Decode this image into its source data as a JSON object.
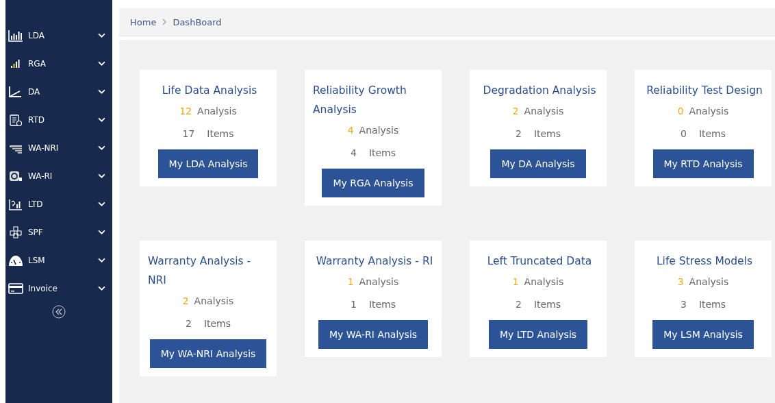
{
  "sidebar": {
    "items": [
      {
        "label": "LDA",
        "expanded": false
      },
      {
        "label": "RGA",
        "expanded": false
      },
      {
        "label": "DA",
        "expanded": false
      },
      {
        "label": "RTD",
        "expanded": false
      },
      {
        "label": "WA-NRI",
        "expanded": false
      },
      {
        "label": "WA-RI",
        "expanded": false
      },
      {
        "label": "LTD",
        "expanded": false
      },
      {
        "label": "SPF",
        "expanded": false
      },
      {
        "label": "LSM",
        "expanded": false
      },
      {
        "label": "Invoice",
        "expanded": false
      }
    ]
  },
  "breadcrumb": [
    "Home",
    "DashBoard"
  ],
  "cards": [
    {
      "title": "Life Data Analysis",
      "analysis_count": "12",
      "analysis_label": "Analysis",
      "items_count": "17",
      "items_label": "Items",
      "button": "My LDA Analysis"
    },
    {
      "title": "Reliability Growth Analysis",
      "analysis_count": "4",
      "analysis_label": "Analysis",
      "items_count": "4",
      "items_label": "Items",
      "button": "My RGA Analysis"
    },
    {
      "title": "Degradation Analysis",
      "analysis_count": "2",
      "analysis_label": "Analysis",
      "items_count": "2",
      "items_label": "Items",
      "button": "My DA Analysis"
    },
    {
      "title": "Reliability Test Design",
      "analysis_count": "0",
      "analysis_label": "Analysis",
      "items_count": "0",
      "items_label": "Items",
      "button": "My RTD Analysis"
    },
    {
      "title": "Warranty Analysis - NRI",
      "analysis_count": "2",
      "analysis_label": "Analysis",
      "items_count": "2",
      "items_label": "Items",
      "button": "My WA-NRI Analysis"
    },
    {
      "title": "Warranty Analysis - RI",
      "analysis_count": "1",
      "analysis_label": "Analysis",
      "items_count": "1",
      "items_label": "Items",
      "button": "My WA-RI Analysis"
    },
    {
      "title": "Left Truncated Data",
      "analysis_count": "1",
      "analysis_label": "Analysis",
      "items_count": "2",
      "items_label": "Items",
      "button": "My LTD Analysis"
    },
    {
      "title": "Life Stress Models",
      "analysis_count": "3",
      "analysis_label": "Analysis",
      "items_count": "3",
      "items_label": "Items",
      "button": "My LSM Analysis"
    }
  ]
}
